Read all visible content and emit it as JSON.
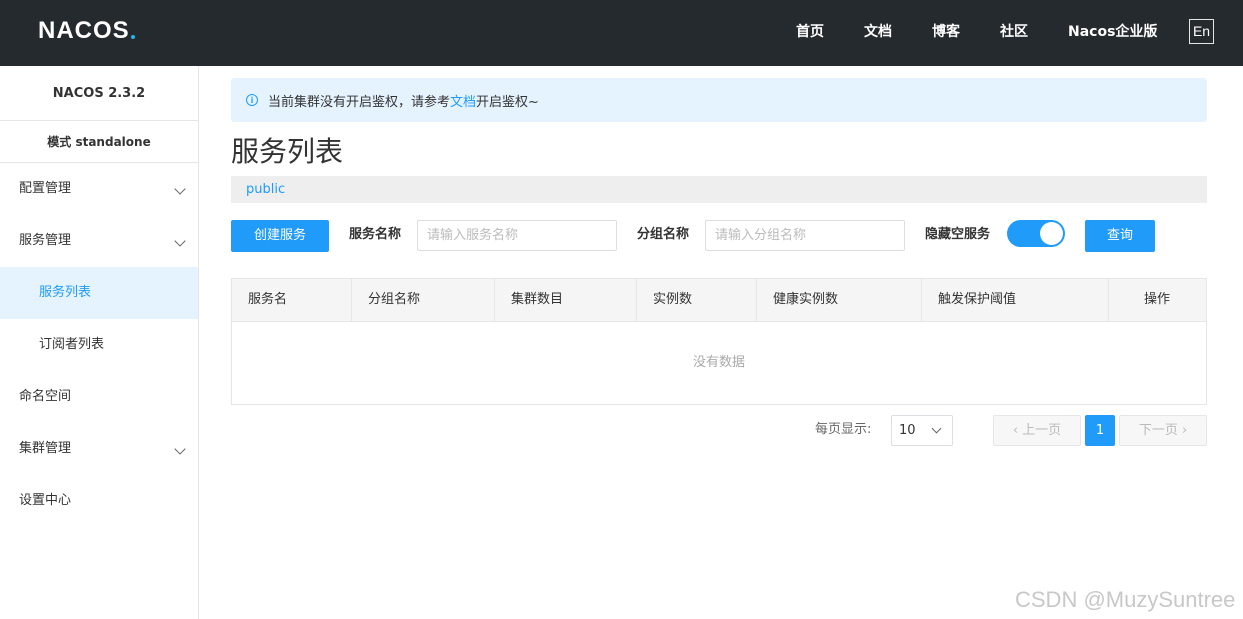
{
  "header": {
    "logo_text": "NACOS",
    "nav": [
      "首页",
      "文档",
      "博客",
      "社区",
      "Nacos企业版"
    ],
    "lang_button": "En"
  },
  "sidebar": {
    "version": "NACOS 2.3.2",
    "mode": "模式 standalone",
    "items": [
      {
        "label": "配置管理"
      },
      {
        "label": "服务管理"
      },
      {
        "label": "服务列表"
      },
      {
        "label": "订阅者列表"
      },
      {
        "label": "命名空间"
      },
      {
        "label": "集群管理"
      },
      {
        "label": "设置中心"
      }
    ]
  },
  "notice": {
    "prefix": "当前集群没有开启鉴权，请参考",
    "link": "文档",
    "suffix": "开启鉴权~"
  },
  "page": {
    "title": "服务列表",
    "namespace": "public"
  },
  "toolbar": {
    "create_button": "创建服务",
    "service_name_label": "服务名称",
    "service_name_placeholder": "请输入服务名称",
    "group_name_label": "分组名称",
    "group_name_placeholder": "请输入分组名称",
    "hide_empty_label": "隐藏空服务",
    "hide_empty_on": true,
    "query_button": "查询"
  },
  "table": {
    "columns": [
      "服务名",
      "分组名称",
      "集群数目",
      "实例数",
      "健康实例数",
      "触发保护阈值",
      "操作"
    ],
    "empty_text": "没有数据"
  },
  "pagination": {
    "page_size_label": "每页显示:",
    "page_size": "10",
    "prev_label": "上一页",
    "current_page": "1",
    "next_label": "下一页"
  },
  "watermark": "CSDN @MuzySuntree",
  "colors": {
    "header_bg": "#252a2f",
    "primary": "#209bfa",
    "active_bg": "#e5f3ff"
  }
}
